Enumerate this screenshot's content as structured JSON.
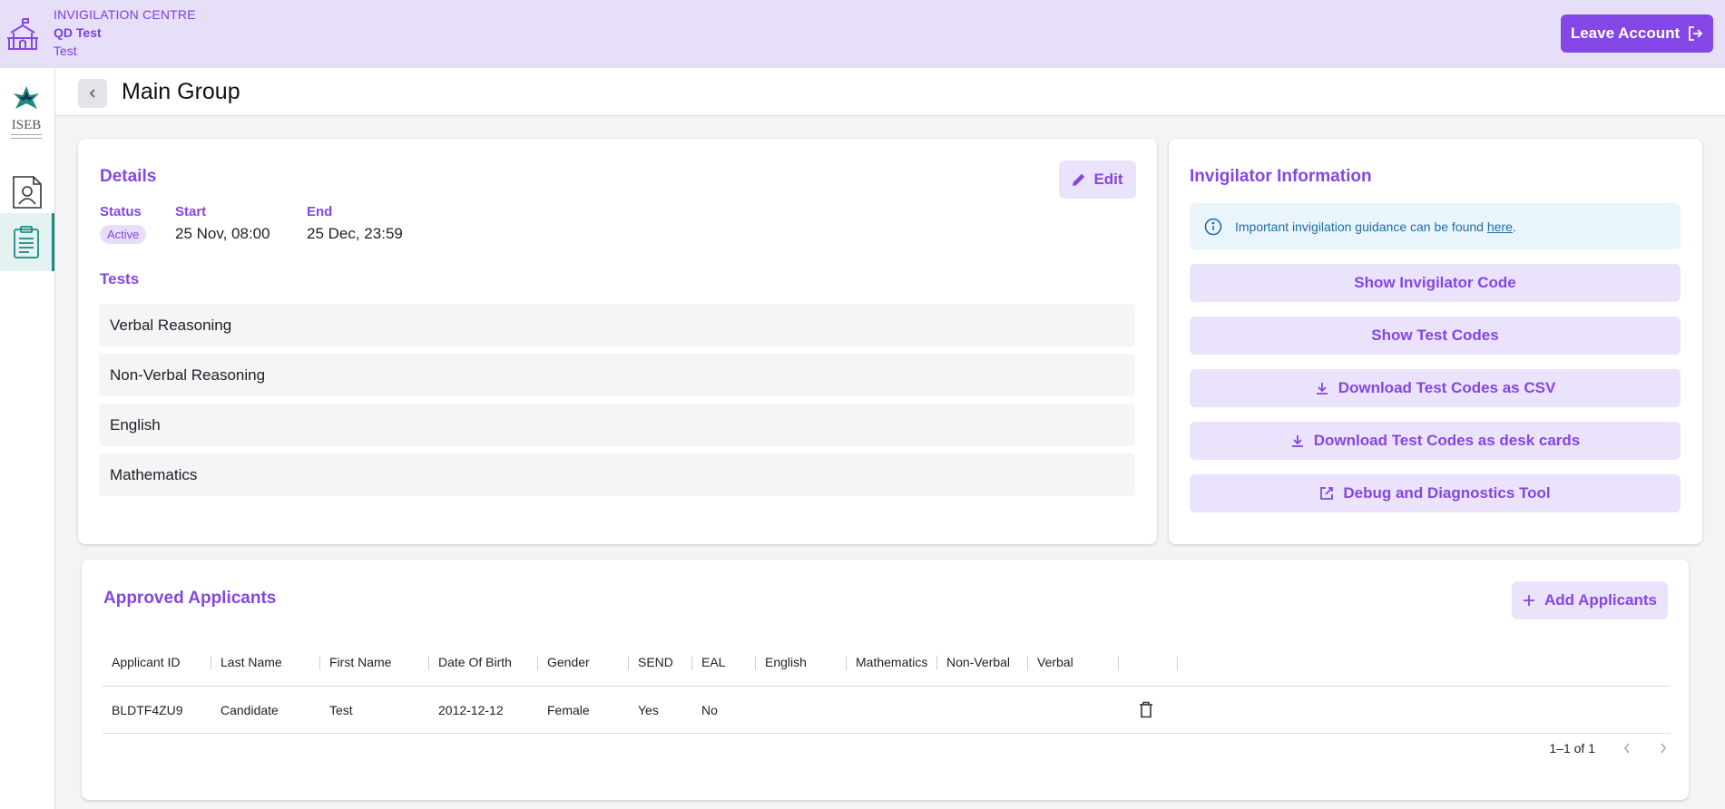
{
  "topbar": {
    "centre_label": "INVIGILATION CENTRE",
    "centre_name": "QD Test",
    "centre_sub": "Test",
    "leave_label": "Leave Account"
  },
  "sidebar": {
    "logo_text": "ISEB",
    "items": [
      {
        "name": "profile",
        "active": false
      },
      {
        "name": "clipboard",
        "active": true
      }
    ]
  },
  "header": {
    "title": "Main Group"
  },
  "details": {
    "title": "Details",
    "edit_label": "Edit",
    "status_label": "Status",
    "status_value": "Active",
    "start_label": "Start",
    "start_value": "25 Nov, 08:00",
    "end_label": "End",
    "end_value": "25 Dec, 23:59",
    "tests_label": "Tests",
    "tests": [
      "Verbal Reasoning",
      "Non-Verbal Reasoning",
      "English",
      "Mathematics"
    ]
  },
  "invigilator": {
    "title": "Invigilator Information",
    "info_text": "Important invigilation guidance can be found ",
    "info_link": "here",
    "info_end": ".",
    "buttons": [
      {
        "label": "Show Invigilator Code",
        "icon": ""
      },
      {
        "label": "Show Test Codes",
        "icon": ""
      },
      {
        "label": "Download Test Codes as CSV",
        "icon": "download-icon"
      },
      {
        "label": "Download Test Codes as desk cards",
        "icon": "download-icon"
      },
      {
        "label": "Debug and Diagnostics Tool",
        "icon": "external-link-icon"
      }
    ]
  },
  "applicants": {
    "title": "Approved Applicants",
    "add_label": "Add Applicants",
    "columns": [
      "Applicant ID",
      "Last Name",
      "First Name",
      "Date Of Birth",
      "Gender",
      "SEND",
      "EAL",
      "English",
      "Mathematics",
      "Non-Verbal",
      "Verbal",
      "",
      ""
    ],
    "rows": [
      [
        "BLDTF4ZU9",
        "Candidate",
        "Test",
        "2012-12-12",
        "Female",
        "Yes",
        "No",
        "",
        "",
        "",
        "",
        "",
        ""
      ]
    ],
    "pagination": "1–1 of 1"
  },
  "colors": {
    "accent": "#8446e4",
    "topbar_bg": "#e7dff8",
    "teal": "#1f8a84"
  }
}
